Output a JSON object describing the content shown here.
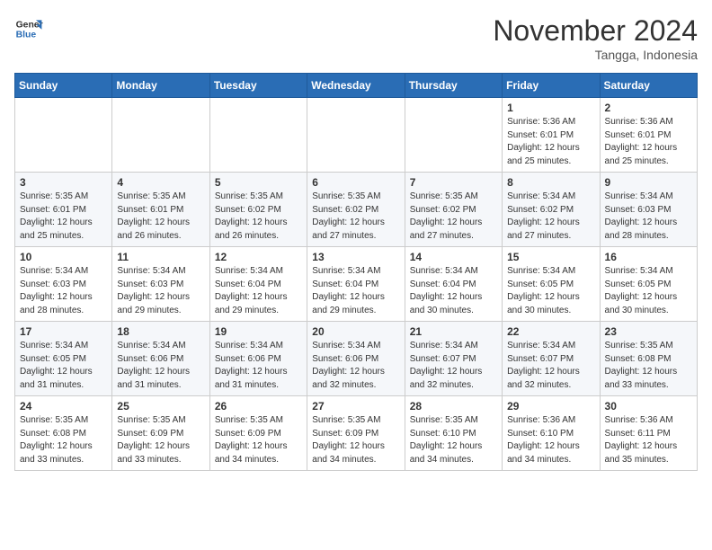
{
  "header": {
    "logo_line1": "General",
    "logo_line2": "Blue",
    "month": "November 2024",
    "location": "Tangga, Indonesia"
  },
  "days_of_week": [
    "Sunday",
    "Monday",
    "Tuesday",
    "Wednesday",
    "Thursday",
    "Friday",
    "Saturday"
  ],
  "weeks": [
    [
      {
        "day": "",
        "info": ""
      },
      {
        "day": "",
        "info": ""
      },
      {
        "day": "",
        "info": ""
      },
      {
        "day": "",
        "info": ""
      },
      {
        "day": "",
        "info": ""
      },
      {
        "day": "1",
        "info": "Sunrise: 5:36 AM\nSunset: 6:01 PM\nDaylight: 12 hours and 25 minutes."
      },
      {
        "day": "2",
        "info": "Sunrise: 5:36 AM\nSunset: 6:01 PM\nDaylight: 12 hours and 25 minutes."
      }
    ],
    [
      {
        "day": "3",
        "info": "Sunrise: 5:35 AM\nSunset: 6:01 PM\nDaylight: 12 hours and 25 minutes."
      },
      {
        "day": "4",
        "info": "Sunrise: 5:35 AM\nSunset: 6:01 PM\nDaylight: 12 hours and 26 minutes."
      },
      {
        "day": "5",
        "info": "Sunrise: 5:35 AM\nSunset: 6:02 PM\nDaylight: 12 hours and 26 minutes."
      },
      {
        "day": "6",
        "info": "Sunrise: 5:35 AM\nSunset: 6:02 PM\nDaylight: 12 hours and 27 minutes."
      },
      {
        "day": "7",
        "info": "Sunrise: 5:35 AM\nSunset: 6:02 PM\nDaylight: 12 hours and 27 minutes."
      },
      {
        "day": "8",
        "info": "Sunrise: 5:34 AM\nSunset: 6:02 PM\nDaylight: 12 hours and 27 minutes."
      },
      {
        "day": "9",
        "info": "Sunrise: 5:34 AM\nSunset: 6:03 PM\nDaylight: 12 hours and 28 minutes."
      }
    ],
    [
      {
        "day": "10",
        "info": "Sunrise: 5:34 AM\nSunset: 6:03 PM\nDaylight: 12 hours and 28 minutes."
      },
      {
        "day": "11",
        "info": "Sunrise: 5:34 AM\nSunset: 6:03 PM\nDaylight: 12 hours and 29 minutes."
      },
      {
        "day": "12",
        "info": "Sunrise: 5:34 AM\nSunset: 6:04 PM\nDaylight: 12 hours and 29 minutes."
      },
      {
        "day": "13",
        "info": "Sunrise: 5:34 AM\nSunset: 6:04 PM\nDaylight: 12 hours and 29 minutes."
      },
      {
        "day": "14",
        "info": "Sunrise: 5:34 AM\nSunset: 6:04 PM\nDaylight: 12 hours and 30 minutes."
      },
      {
        "day": "15",
        "info": "Sunrise: 5:34 AM\nSunset: 6:05 PM\nDaylight: 12 hours and 30 minutes."
      },
      {
        "day": "16",
        "info": "Sunrise: 5:34 AM\nSunset: 6:05 PM\nDaylight: 12 hours and 30 minutes."
      }
    ],
    [
      {
        "day": "17",
        "info": "Sunrise: 5:34 AM\nSunset: 6:05 PM\nDaylight: 12 hours and 31 minutes."
      },
      {
        "day": "18",
        "info": "Sunrise: 5:34 AM\nSunset: 6:06 PM\nDaylight: 12 hours and 31 minutes."
      },
      {
        "day": "19",
        "info": "Sunrise: 5:34 AM\nSunset: 6:06 PM\nDaylight: 12 hours and 31 minutes."
      },
      {
        "day": "20",
        "info": "Sunrise: 5:34 AM\nSunset: 6:06 PM\nDaylight: 12 hours and 32 minutes."
      },
      {
        "day": "21",
        "info": "Sunrise: 5:34 AM\nSunset: 6:07 PM\nDaylight: 12 hours and 32 minutes."
      },
      {
        "day": "22",
        "info": "Sunrise: 5:34 AM\nSunset: 6:07 PM\nDaylight: 12 hours and 32 minutes."
      },
      {
        "day": "23",
        "info": "Sunrise: 5:35 AM\nSunset: 6:08 PM\nDaylight: 12 hours and 33 minutes."
      }
    ],
    [
      {
        "day": "24",
        "info": "Sunrise: 5:35 AM\nSunset: 6:08 PM\nDaylight: 12 hours and 33 minutes."
      },
      {
        "day": "25",
        "info": "Sunrise: 5:35 AM\nSunset: 6:09 PM\nDaylight: 12 hours and 33 minutes."
      },
      {
        "day": "26",
        "info": "Sunrise: 5:35 AM\nSunset: 6:09 PM\nDaylight: 12 hours and 34 minutes."
      },
      {
        "day": "27",
        "info": "Sunrise: 5:35 AM\nSunset: 6:09 PM\nDaylight: 12 hours and 34 minutes."
      },
      {
        "day": "28",
        "info": "Sunrise: 5:35 AM\nSunset: 6:10 PM\nDaylight: 12 hours and 34 minutes."
      },
      {
        "day": "29",
        "info": "Sunrise: 5:36 AM\nSunset: 6:10 PM\nDaylight: 12 hours and 34 minutes."
      },
      {
        "day": "30",
        "info": "Sunrise: 5:36 AM\nSunset: 6:11 PM\nDaylight: 12 hours and 35 minutes."
      }
    ]
  ]
}
